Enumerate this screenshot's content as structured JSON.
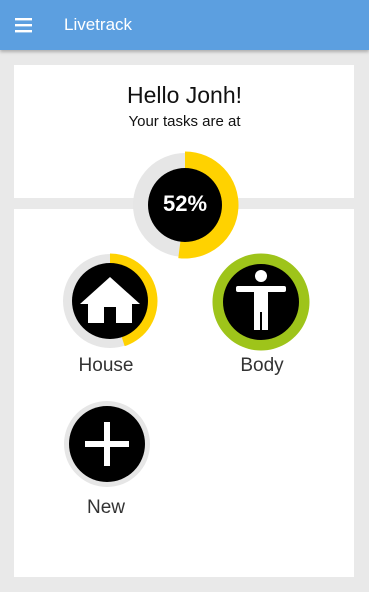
{
  "appbar": {
    "title": "Livetrack",
    "menu_icon": "hamburger-menu-icon"
  },
  "header": {
    "greeting": "Hello Jonh!",
    "subtitle": "Your tasks are at"
  },
  "summary": {
    "percent_label": "52%",
    "progress": 0.52,
    "color": "#ffd200"
  },
  "tiles": [
    {
      "label": "House",
      "icon": "house-icon",
      "progress": 0.45,
      "color": "#ffd200"
    },
    {
      "label": "Body",
      "icon": "person-body-icon",
      "progress": 1.0,
      "color": "#9ec41a"
    },
    {
      "label": "New",
      "icon": "plus-icon"
    }
  ],
  "colors": {
    "appbar": "#5c9fe0",
    "track": "#e6e6e6",
    "disc": "#000000"
  }
}
